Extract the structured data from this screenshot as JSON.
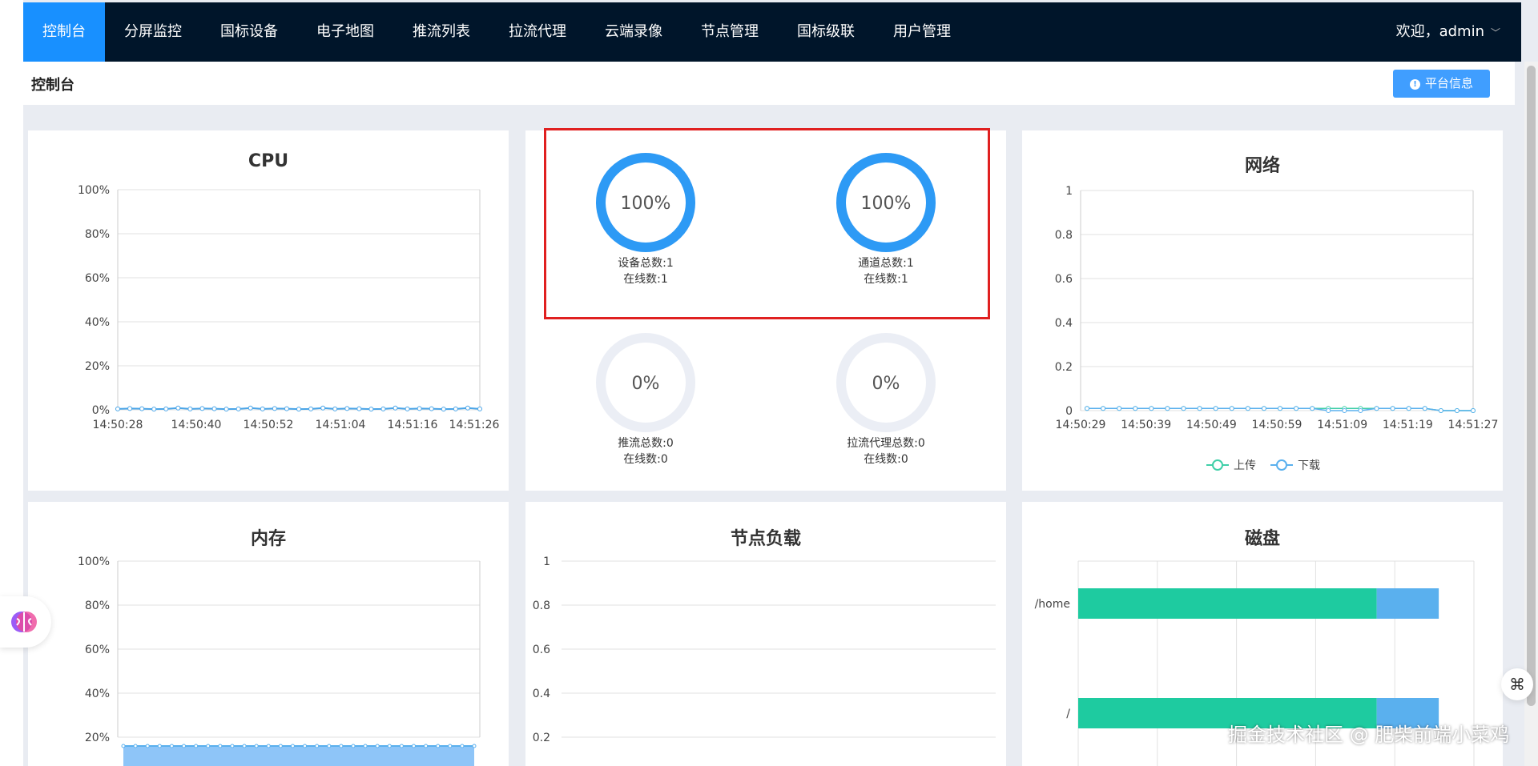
{
  "nav": {
    "items": [
      {
        "label": "控制台",
        "active": true
      },
      {
        "label": "分屏监控"
      },
      {
        "label": "国标设备"
      },
      {
        "label": "电子地图"
      },
      {
        "label": "推流列表"
      },
      {
        "label": "拉流代理"
      },
      {
        "label": "云端录像"
      },
      {
        "label": "节点管理"
      },
      {
        "label": "国标级联"
      },
      {
        "label": "用户管理"
      }
    ],
    "user": "欢迎，admin"
  },
  "header": {
    "title": "控制台",
    "platform_button": "平台信息",
    "info_icon_glyph": "!"
  },
  "cpu": {
    "title": "CPU",
    "y_ticks": [
      "100%",
      "80%",
      "60%",
      "40%",
      "20%",
      "0%"
    ],
    "x_ticks": [
      "14:50:28",
      "14:50:40",
      "14:50:52",
      "14:51:04",
      "14:51:16",
      "14:51:26"
    ]
  },
  "stats": {
    "device": {
      "percent": "100%",
      "total": "设备总数:1",
      "online": "在线数:1",
      "value": 1.0
    },
    "channel": {
      "percent": "100%",
      "total": "通道总数:1",
      "online": "在线数:1",
      "value": 1.0
    },
    "push": {
      "percent": "0%",
      "total": "推流总数:0",
      "online": "在线数:0",
      "value": 0
    },
    "proxy": {
      "percent": "0%",
      "total": "拉流代理总数:0",
      "online": "在线数:0",
      "value": 0
    }
  },
  "network": {
    "title": "网络",
    "y_ticks": [
      "1",
      "0.8",
      "0.6",
      "0.4",
      "0.2",
      "0"
    ],
    "x_ticks": [
      "14:50:29",
      "14:50:39",
      "14:50:49",
      "14:50:59",
      "14:51:09",
      "14:51:19",
      "14:51:27"
    ],
    "legend": [
      "上传",
      "下载"
    ]
  },
  "memory": {
    "title": "内存",
    "y_ticks": [
      "100%",
      "80%",
      "60%",
      "40%",
      "20%"
    ]
  },
  "node_load": {
    "title": "节点负载",
    "y_ticks": [
      "1",
      "0.8",
      "0.6",
      "0.4",
      "0.2"
    ]
  },
  "disk": {
    "title": "磁盘",
    "categories": [
      "/home",
      "/"
    ]
  },
  "watermark": "掘金技术社区 @ 肥柴前端小菜鸡",
  "colors": {
    "nav_bg": "#00152a",
    "accent": "#1890ff",
    "ring": "#2d9af5",
    "teal": "#1ecba0",
    "light_blue": "#5ab0ee"
  },
  "chart_data": [
    {
      "type": "line",
      "title": "CPU",
      "x": [
        "14:50:28",
        "14:50:40",
        "14:50:52",
        "14:51:04",
        "14:51:16",
        "14:51:26"
      ],
      "series": [
        {
          "values": [
            0.4,
            0.6,
            0.5,
            0.3,
            0.4,
            0.8
          ]
        }
      ],
      "ylim": [
        0,
        100
      ]
    },
    {
      "type": "line",
      "title": "网络",
      "x": [
        "14:50:29",
        "14:50:39",
        "14:50:49",
        "14:50:59",
        "14:51:09",
        "14:51:19",
        "14:51:27"
      ],
      "series": [
        {
          "name": "上传",
          "values": [
            0.01,
            0.01,
            0.01,
            0.01,
            0.01,
            0.01,
            0.0
          ]
        },
        {
          "name": "下载",
          "values": [
            0.01,
            0.01,
            0.01,
            0.01,
            0.0,
            0.01,
            0.0
          ]
        }
      ],
      "ylim": [
        0,
        1
      ]
    },
    {
      "type": "area",
      "title": "内存",
      "series": [
        {
          "values": [
            16,
            16,
            16,
            16,
            16,
            16,
            16,
            16,
            16,
            16,
            16,
            16,
            16,
            16,
            16,
            16,
            16,
            16,
            16,
            16,
            16,
            16,
            16,
            16,
            16,
            16,
            16,
            16,
            16,
            16
          ]
        }
      ],
      "ylim": [
        0,
        100
      ]
    },
    {
      "type": "bar",
      "title": "磁盘",
      "categories": [
        "/home",
        "/"
      ],
      "series": [
        {
          "values": [
            0.77,
            0.77
          ]
        },
        {
          "values": [
            0.16,
            0.16
          ]
        }
      ]
    }
  ]
}
